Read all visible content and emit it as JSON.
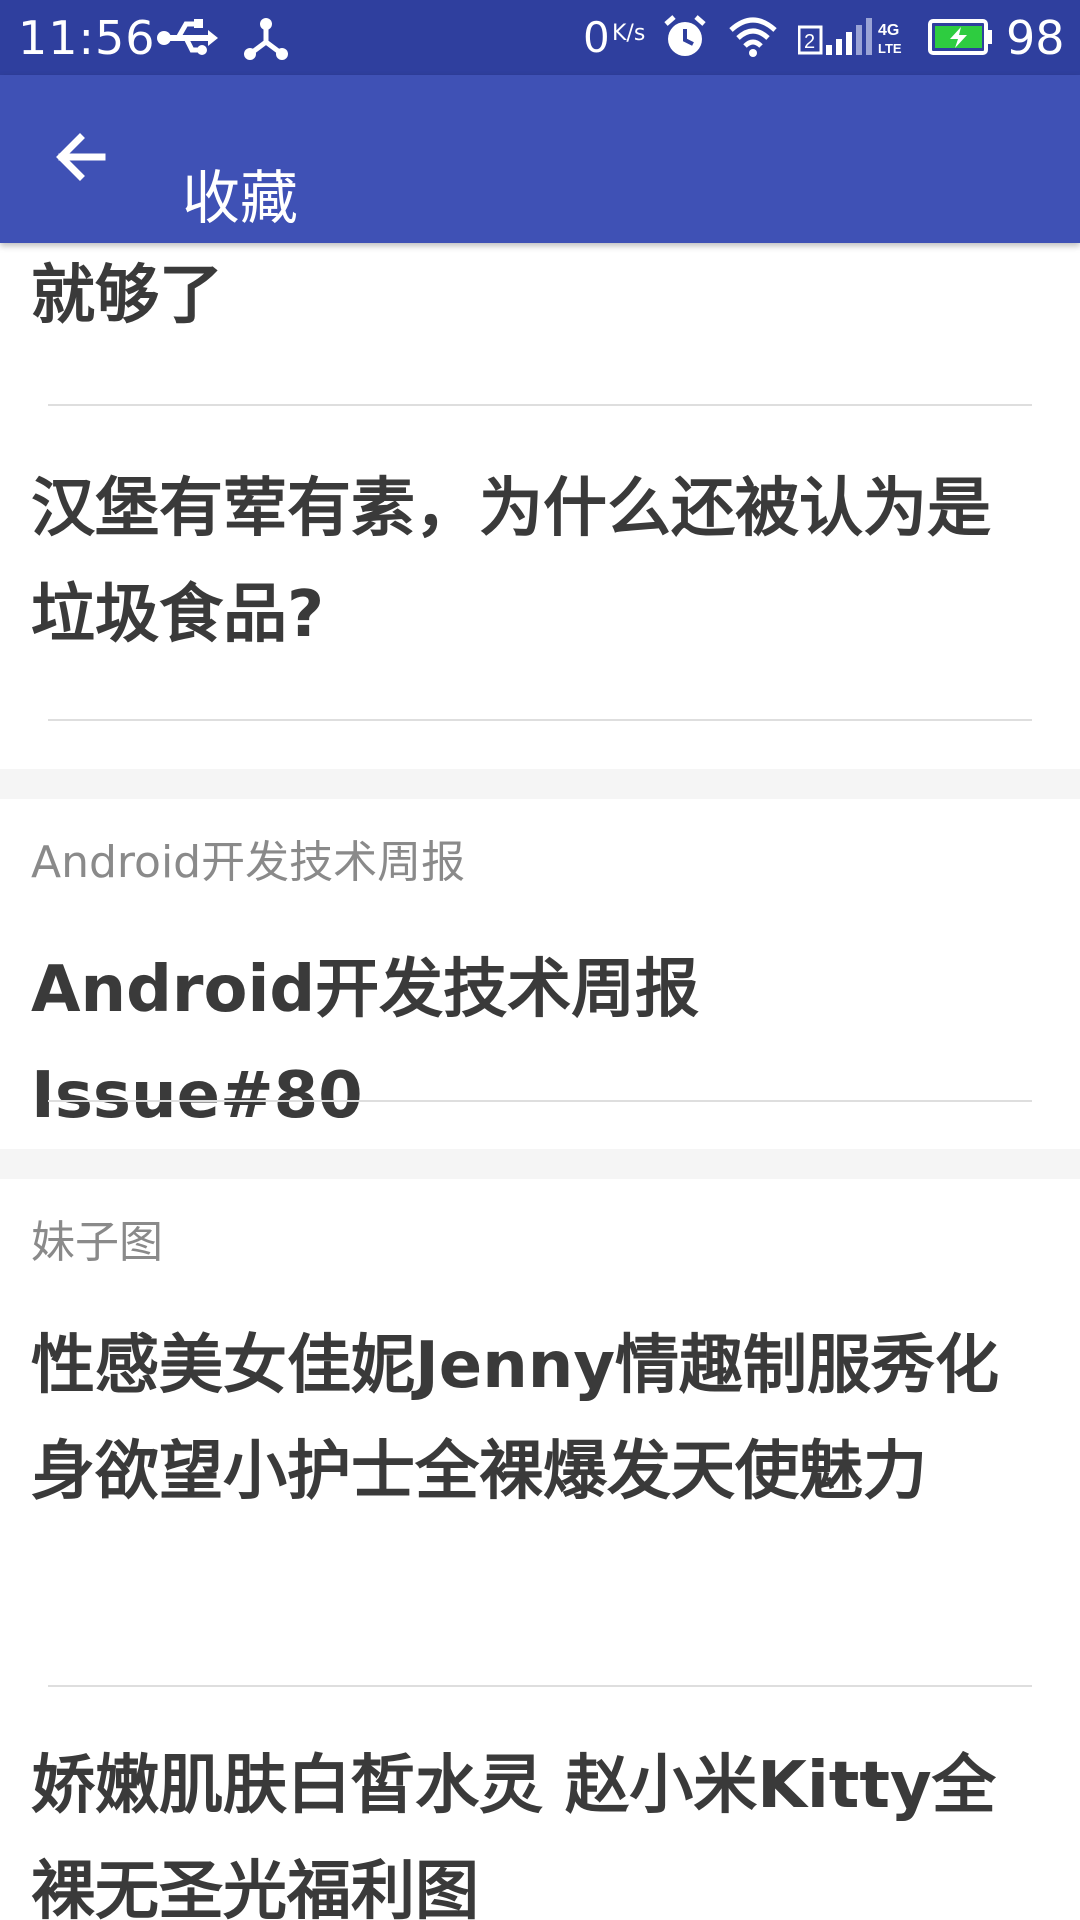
{
  "status_bar": {
    "time": "11:56",
    "network_speed": "0",
    "network_speed_unit": "K/s",
    "sim_slot": "2",
    "network_type": "4G LTE",
    "battery_level": "98",
    "icons": [
      "usb-icon",
      "share-icon",
      "alarm-icon",
      "wifi-icon",
      "signal-icon",
      "battery-charging-icon"
    ]
  },
  "app_bar": {
    "title": "收藏",
    "back_icon": "arrow-back-icon",
    "color": "#3f51b5"
  },
  "favorites": {
    "partial_item_title": "就够了",
    "items": [
      {
        "title": "汉堡有荤有素，为什么还被认为是垃圾食品?"
      },
      {
        "category": "Android开发技术周报",
        "title": "Android开发技术周报 Issue#80"
      },
      {
        "category": "妹子图",
        "title": "性感美女佳妮Jenny情趣制服秀化身欲望小护士全裸爆发天使魅力"
      },
      {
        "title": "娇嫩肌肤白皙水灵 赵小米Kitty全裸无圣光福利图"
      }
    ]
  }
}
